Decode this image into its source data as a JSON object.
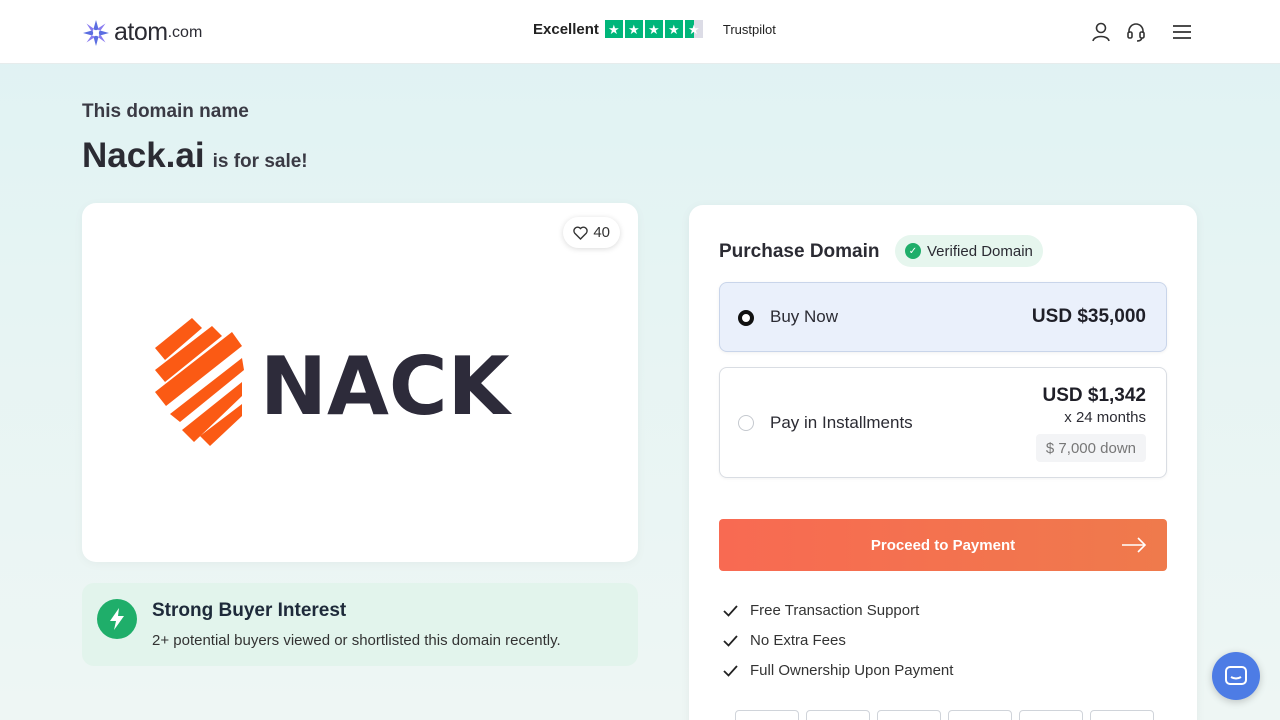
{
  "header": {
    "logo": {
      "name": "atom",
      "suffix": ".com"
    },
    "trustpilot": {
      "label": "Excellent",
      "rating_stars": 4.5,
      "brand": "Trustpilot",
      "star_color": "#00b67a"
    },
    "icons": [
      "user-icon",
      "headset-icon",
      "menu-icon"
    ]
  },
  "hero": {
    "pre_title": "This domain name",
    "domain": "Nack.ai",
    "for_sale": "is for sale!"
  },
  "logo_card": {
    "likes": "40",
    "brand_text": "NACK",
    "brand_colors": {
      "mark": "#fb5a14",
      "text": "#2d2b3a"
    }
  },
  "interest": {
    "title": "Strong Buyer Interest",
    "text": "2+ potential buyers viewed or shortlisted this domain recently."
  },
  "purchase": {
    "title": "Purchase Domain",
    "verified_label": "Verified Domain",
    "options": [
      {
        "label": "Buy Now",
        "price": "USD $35,000",
        "selected": true
      },
      {
        "label": "Pay in Installments",
        "price": "USD $1,342",
        "term": "x 24 months",
        "down": "$ 7,000 down",
        "selected": false
      }
    ],
    "cta": "Proceed to Payment",
    "perks": [
      "Free Transaction Support",
      "No Extra Fees",
      "Full Ownership Upon Payment"
    ],
    "accent_color": "#f86a52"
  }
}
